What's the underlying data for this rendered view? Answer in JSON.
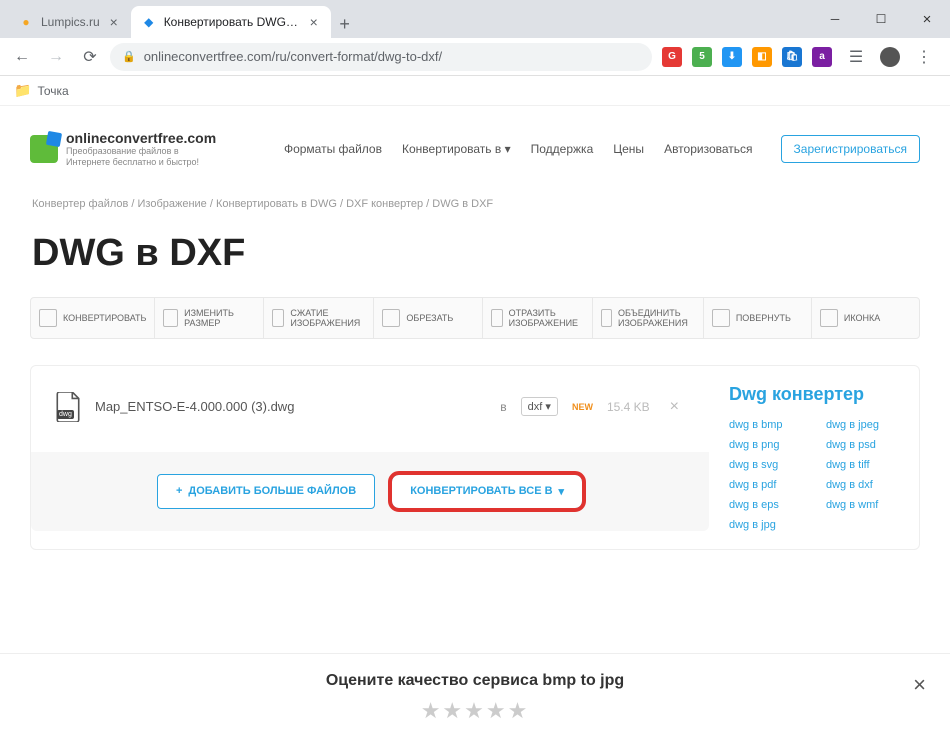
{
  "tabs": [
    {
      "title": "Lumpics.ru",
      "faviconColor": "#f5a623"
    },
    {
      "title": "Конвертировать DWG в DXF он",
      "faviconColor": "#1e88e5"
    }
  ],
  "url": "onlineconvertfree.com/ru/convert-format/dwg-to-dxf/",
  "bookmark": "Точка",
  "site": {
    "name": "onlineconvertfree.com",
    "tagline": "Преобразование файлов в Интернете бесплатно и быстро!"
  },
  "nav": {
    "formats": "Форматы файлов",
    "convert": "Конвертировать в",
    "support": "Поддержка",
    "pricing": "Цены",
    "login": "Авторизоваться",
    "register": "Зарегистрироваться"
  },
  "crumbs": "Конвертер файлов / Изображение / Конвертировать в DWG / DXF конвертер / DWG в DXF",
  "h1": "DWG в DXF",
  "tools": {
    "convert": "КОНВЕРТИРОВАТЬ",
    "resize": "ИЗМЕНИТЬ РАЗМЕР",
    "compress": "СЖАТИЕ ИЗОБРАЖЕНИЯ",
    "crop": "ОБРЕЗАТЬ",
    "flip": "ОТРАЗИТЬ ИЗОБРАЖЕНИЕ",
    "merge": "ОБЪЕДИНИТЬ ИЗОБРАЖЕНИЯ",
    "rotate": "ПОВЕРНУТЬ",
    "icon": "ИКОНКА"
  },
  "file": {
    "name": "Map_ENTSO-E-4.000.000 (3).dwg",
    "iconLabel": "dwg",
    "to": "в",
    "format": "dxf",
    "new": "NEW",
    "size": "15.4 KB"
  },
  "buttons": {
    "add": "ДОБАВИТЬ БОЛЬШЕ ФАЙЛОВ",
    "convertAll": "КОНВЕРТИРОВАТЬ ВСЕ В"
  },
  "sidebar": {
    "title": "Dwg конвертер",
    "links": [
      "dwg в bmp",
      "dwg в jpeg",
      "dwg в png",
      "dwg в psd",
      "dwg в svg",
      "dwg в tiff",
      "dwg в pdf",
      "dwg в dxf",
      "dwg в eps",
      "dwg в wmf",
      "dwg в jpg"
    ]
  },
  "rate": {
    "title": "Оцените качество сервиса bmp to jpg"
  }
}
